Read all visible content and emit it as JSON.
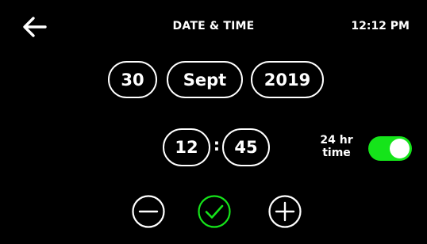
{
  "header": {
    "title": "DATE & TIME",
    "clock": "12:12 PM",
    "back_icon": "arrow-left-icon"
  },
  "date": {
    "day": "30",
    "month": "Sept",
    "year": "2019"
  },
  "time": {
    "hour": "12",
    "separator": ":",
    "minute": "45"
  },
  "format_toggle": {
    "label_line1": "24 hr",
    "label_line2": "time",
    "enabled": true,
    "on_color": "#15e41a"
  },
  "controls": {
    "decrement_icon": "minus-circle-icon",
    "confirm_icon": "check-circle-icon",
    "increment_icon": "plus-circle-icon",
    "confirm_color": "#15e41a"
  }
}
